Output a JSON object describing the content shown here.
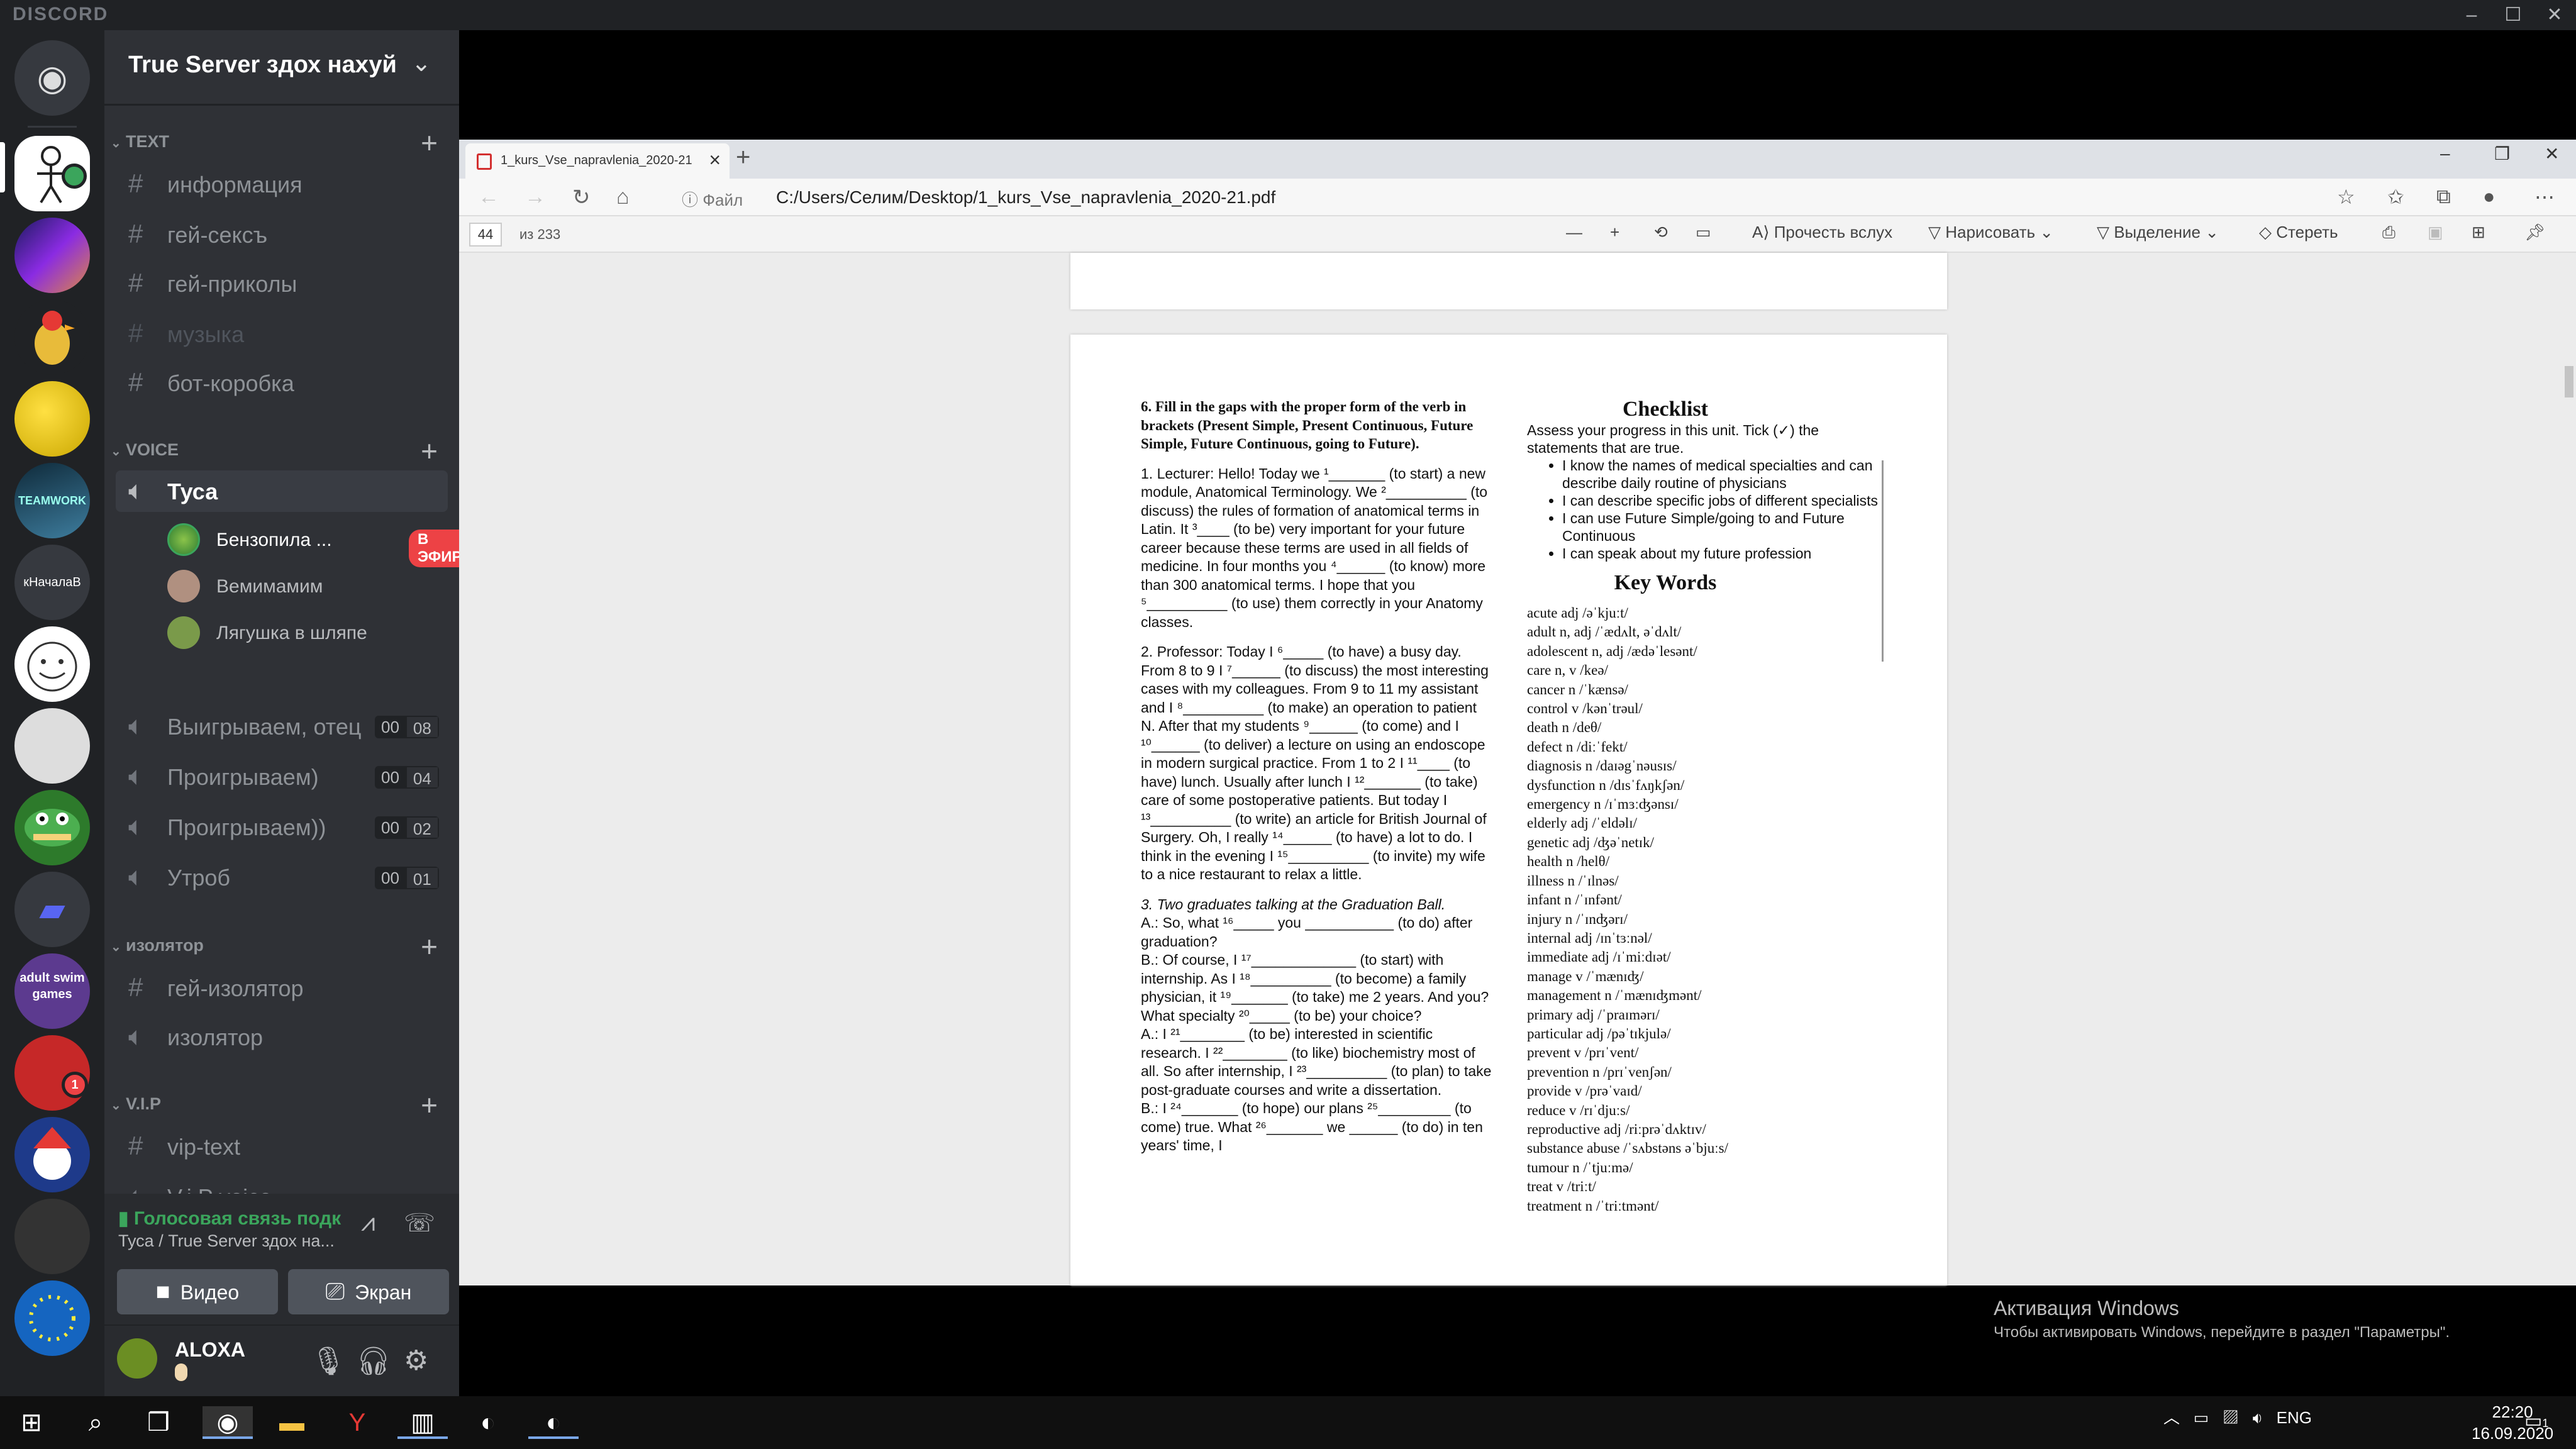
{
  "discord": {
    "brand": "DISCORD",
    "server_name": "True Server здох нахуй",
    "categories": {
      "text": "TEXT",
      "voice": "VOICE",
      "isolator": "изолятор",
      "vip": "V.I.P"
    },
    "text_channels": [
      "информация",
      "гей-сексъ",
      "гей-приколы",
      "музыка",
      "бот-коробка"
    ],
    "voice_active": "Туса",
    "voice_users": [
      {
        "name": "Бензопила ...",
        "live": "В ЭФИРЕ"
      },
      {
        "name": "Вемимамим"
      },
      {
        "name": "Лягушка в шляпе"
      }
    ],
    "voice_channels": [
      {
        "name": "Выигрываем, отец",
        "c1": "00",
        "c2": "08"
      },
      {
        "name": "Проигрываем)",
        "c1": "00",
        "c2": "04"
      },
      {
        "name": "Проигрываем))",
        "c1": "00",
        "c2": "02"
      },
      {
        "name": "Утроб",
        "c1": "00",
        "c2": "01"
      }
    ],
    "isolator_channels": [
      "гей-изолятор",
      "изолятор"
    ],
    "vip_channels": [
      "vip-text",
      "V.i.P voice"
    ],
    "server_labels": [
      "кНачалаВ",
      "adult swim games"
    ],
    "mention_count": "1",
    "voice_panel": {
      "status": "Голосовая связь подк",
      "where": "Туса / True Server здох на...",
      "video": "Видео",
      "screen": "Экран"
    },
    "user": {
      "name": "ALOXA"
    }
  },
  "browser": {
    "tab_title": "1_kurs_Vse_napravlenia_2020-21",
    "file_label": "Файл",
    "url": "C:/Users/Селим/Desktop/1_kurs_Vse_napravlenia_2020-21.pdf",
    "page_current": "44",
    "page_total": "из 233",
    "toolbar": {
      "read_aloud": "Прочесть вслух",
      "draw": "Нарисовать",
      "highlight": "Выделение",
      "erase": "Стереть"
    }
  },
  "pdf": {
    "task6_title": "6. Fill in the gaps with the proper form of the verb in brackets (Present Simple, Present Continuous, Future Simple, Future Continuous, going to Future).",
    "lecturer": "1. Lecturer: Hello! Today we ¹_______ (to start) a new module, Anatomical Terminology. We ²__________ (to discuss) the rules of formation of anatomical terms in Latin. It ³____ (to be) very important for your future career because these terms are used in all fields of medicine. In four months you ⁴______ (to know) more than 300 anatomical terms. I hope that you ⁵__________ (to use) them correctly in your Anatomy classes.",
    "professor": "2. Professor: Today I ⁶_____ (to have) a busy day. From 8 to 9 I ⁷______ (to discuss) the most interesting cases with my colleagues. From 9 to 11 my assistant and I ⁸__________ (to make) an operation to patient N. After that my students ⁹______ (to come) and I ¹⁰______ (to deliver) a lecture on using an endoscope in modern surgical practice. From 1 to 2 I ¹¹____ (to have) lunch. Usually after lunch I ¹²_______ (to take) care of some postoperative patients. But today I ¹³__________ (to write) an article for British Journal of Surgery. Oh, I really ¹⁴______ (to have) a lot to do. I think in the evening I ¹⁵__________ (to invite) my wife to a nice restaurant to relax a little.",
    "graduates_title": "3. Two graduates talking at the Graduation Ball.",
    "dialogue": [
      "A.: So, what ¹⁶_____ you ___________ (to do) after graduation?",
      "B.: Of course, I ¹⁷_____________ (to start) with internship. As I ¹⁸__________ (to become) a family physician, it ¹⁹_______ (to take) me 2 years. And you? What specialty ²⁰_____ (to be) your choice?",
      "A.: I ²¹________ (to be) interested in scientific research. I ²²________ (to like) biochemistry most of all. So after internship, I ²³__________ (to plan) to take post-graduate courses and write a dissertation.",
      "B.: I ²⁴_______ (to hope) our plans ²⁵_________ (to come) true. What ²⁶_______ we ______ (to do) in ten years' time, I"
    ],
    "checklist_title": "Checklist",
    "checklist_intro": "Assess your progress in this unit. Tick (✓) the statements that are true.",
    "checklist_items": [
      "I know the names of medical specialties and can describe daily routine of physicians",
      "I can describe specific jobs of different specialists",
      "I can use Future Simple/going to and Future Continuous",
      "I can speak about my future profession"
    ],
    "key_words_title": "Key Words",
    "key_words": [
      "acute adj /əˈkjuːt/",
      "adult n, adj /ˈædʌlt, əˈdʌlt/",
      "adolescent n, adj /ædəˈlesənt/",
      "care n, v /keə/",
      "cancer n /ˈkænsə/",
      "control v /kənˈtrəul/",
      "death n /deθ/",
      "defect n /diːˈfekt/",
      "diagnosis n /daɪəgˈnəusɪs/",
      "dysfunction n /dɪsˈfʌŋkʃən/",
      "emergency n /ɪˈmɜːʤənsɪ/",
      "elderly adj /ˈeldəlɪ/",
      "genetic adj /ʤəˈnetɪk/",
      "health n /helθ/",
      "illness n /ˈɪlnəs/",
      "infant n /ˈɪnfənt/",
      "injury n /ˈɪnʤərɪ/",
      "internal adj /ɪnˈtɜːnəl/",
      "immediate adj /ɪˈmiːdɪət/",
      "manage v /ˈmænɪʤ/",
      "management n /ˈmænɪʤmənt/",
      "primary adj /ˈpraɪmərɪ/",
      "particular adj /pəˈtɪkjulə/",
      "prevent v /prɪˈvent/",
      "prevention n /prɪˈvenʃən/",
      "provide v /prəˈvaɪd/",
      "reduce v /rɪˈdjuːs/",
      "reproductive adj /riːprəˈdʌktɪv/",
      "substance abuse /ˈsʌbstəns əˈbjuːs/",
      "tumour n /ˈtjuːmə/",
      "treat v /triːt/",
      "treatment n /ˈtriːtmənt/"
    ]
  },
  "watermark": {
    "title": "Активация Windows",
    "sub": "Чтобы активировать Windows, перейдите в раздел \"Параметры\"."
  },
  "taskbar": {
    "lang": "ENG",
    "time": "22:20",
    "date": "16.09.2020",
    "notif": "1"
  }
}
